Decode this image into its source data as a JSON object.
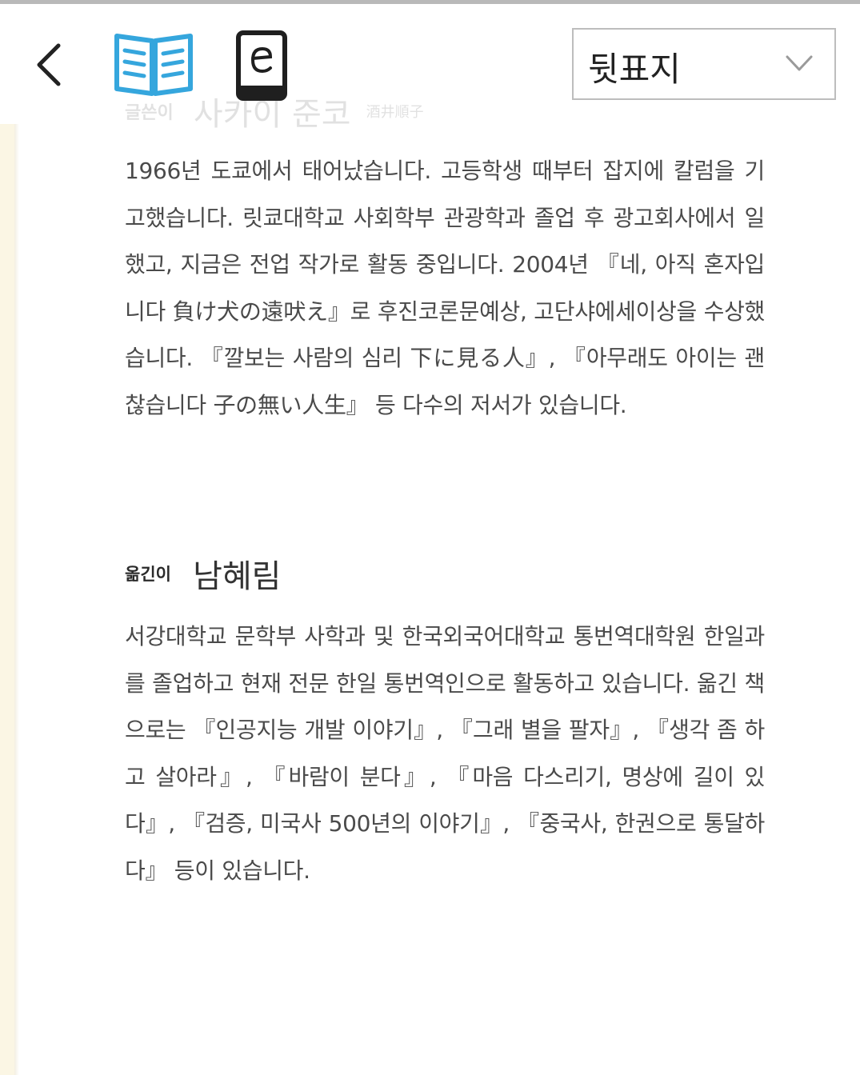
{
  "toolbar": {
    "page_select": {
      "selected": "뒷표지"
    }
  },
  "author": {
    "role": "글쓴이",
    "name": "사카이 준코",
    "original_name": "酒井順子",
    "bio": "1966년 도쿄에서 태어났습니다. 고등학생 때부터 잡지에 칼럼을 기고했습니다. 릿쿄대학교 사회학부 관광학과 졸업 후 광고회사에서 일했고, 지금은 전업 작가로 활동 중입니다. 2004년 『네, 아직 혼자입니다 負け犬の遠吠え』로 후진코론문예상, 고단샤에세이상을 수상했습니다. 『깔보는 사람의 심리 下に見る人』, 『아무래도 아이는 괜찮습니다 子の無い人生』 등 다수의 저서가 있습니다."
  },
  "translator": {
    "role": "옮긴이",
    "name": "남혜림",
    "bio": "서강대학교 문학부 사학과 및 한국외국어대학교 통번역대학원 한일과를 졸업하고 현재 전문 한일 통번역인으로 활동하고 있습니다. 옮긴 책으로는 『인공지능 개발 이야기』, 『그래 별을 팔자』, 『생각 좀 하고 살아라』, 『바람이 분다』, 『마음 다스리기, 명상에 길이 있다』, 『검증, 미국사 500년의 이야기』, 『중국사, 한권으로 통달하다』 등이 있습니다."
  },
  "icons": {
    "back": "chevron-left-icon",
    "book": "open-book-icon",
    "ebook": "ebook-reader-icon",
    "dropdown": "chevron-down-icon"
  },
  "colors": {
    "accent": "#35a6dd",
    "text": "#4a4a4a",
    "page_edge": "#fbf6e4"
  }
}
